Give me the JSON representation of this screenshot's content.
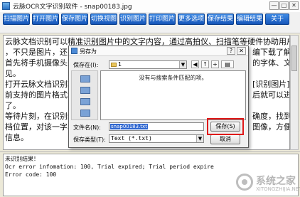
{
  "window": {
    "title": "云脉OCR文字识别软件 - snap00183.jpg",
    "controls": [
      "—",
      "□",
      "✕"
    ]
  },
  "toolbar": {
    "buttons": [
      "扫描图片",
      "打开图片",
      "保存图片",
      "切换视图",
      "识别图片",
      "打印图片",
      "更多选项",
      "保存结果",
      "编辑结果",
      "关于"
    ]
  },
  "main_text": {
    "lines": [
      "云脉文档识别可以精准识别图片中的文字内容，通过高拍仪、扫描笔等硬件协助用户完成OCR识别",
      "，不只是图片，还",
      "首先将手机摄像头对",
      "见。",
      "打开云脉文档识别软件",
      "前支持的图片格式包括",
      "了。",
      "等待片刻，在识别结果",
      "档位置，对该一字段进",
      "信息。"
    ]
  },
  "right_fragments": {
    "lines": [
      "",
      "编下载了解下吧。",
      "的字体、文档清晰",
      "",
      "[识别图片]",
      "后就可以进行识别",
      "",
      "确度，找到错误的",
      "图像，方便核对",
      ""
    ]
  },
  "console": {
    "lines": [
      "未识别结果！",
      "Ocr error infomation: 100, Trial expired; Trial period expire",
      "Error code: 100"
    ]
  },
  "watermark": {
    "text": "系统之家",
    "sub": "XITONGZHIJIA.NET"
  },
  "dialog": {
    "title": "另存为",
    "help": "?",
    "close": "✕",
    "save_in_label": "保存在(I):",
    "save_in_value": "1",
    "empty_message": "没有与搜索条件匹配的项。",
    "filename_label": "文件名(N):",
    "filename_value": "snap00183.txt",
    "filetype_label": "保存类型(T):",
    "filetype_value": "Text (*.txt)",
    "save_button": "保存(S)",
    "cancel_button": "取消"
  },
  "colors": {
    "toolbar_button": "#1e66c8",
    "highlight_box": "#e01818",
    "selection": "#2e66d0"
  }
}
